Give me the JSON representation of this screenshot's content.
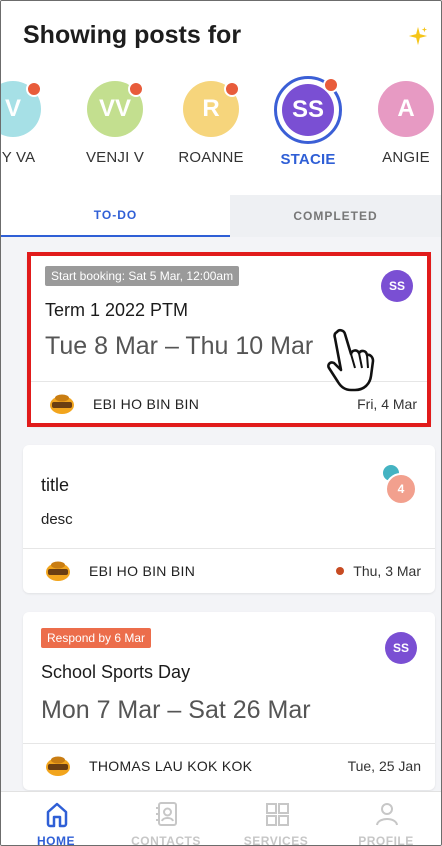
{
  "header": {
    "title": "Showing posts for"
  },
  "children": [
    {
      "initials": "V",
      "name": "CY VA",
      "color": "#a6e0e6",
      "dot": true
    },
    {
      "initials": "VV",
      "name": "VENJI V",
      "color": "#c3df8f",
      "dot": true
    },
    {
      "initials": "R",
      "name": "ROANNE",
      "color": "#f6d57c",
      "dot": true
    },
    {
      "initials": "SS",
      "name": "STACIE",
      "color": "#7a4fd3",
      "dot": true,
      "active": true
    },
    {
      "initials": "A",
      "name": "ANGIE",
      "color": "#e79ac3",
      "dot": false
    }
  ],
  "tabs": {
    "todo": "TO-DO",
    "completed": "COMPLETED"
  },
  "posts": [
    {
      "badge": "Start booking: Sat 5 Mar, 12:00am",
      "title": "Term 1 2022 PTM",
      "range": "Tue 8 Mar – Thu 10 Mar",
      "avatar": "SS",
      "poster": "EBI HO BIN BIN",
      "date": "Fri, 4 Mar"
    },
    {
      "title": "title",
      "desc": "desc",
      "avatar_count": "4",
      "poster": "EBI HO BIN BIN",
      "date": "Thu, 3 Mar"
    },
    {
      "badge": "Respond by 6 Mar",
      "title": "School Sports Day",
      "range": "Mon 7 Mar – Sat 26 Mar",
      "avatar": "SS",
      "poster": "THOMAS LAU KOK KOK",
      "date": "Tue, 25 Jan"
    }
  ],
  "nav": [
    {
      "label": "HOME",
      "icon": "home-icon",
      "active": true
    },
    {
      "label": "CONTACTS",
      "icon": "contacts-icon"
    },
    {
      "label": "SERVICES",
      "icon": "services-icon"
    },
    {
      "label": "PROFILE",
      "icon": "profile-icon"
    }
  ],
  "colors": {
    "accent": "#2f5fd6",
    "notification": "#e85c3b",
    "highlight": "#e11b1b",
    "sparkle": "#f5c518"
  }
}
